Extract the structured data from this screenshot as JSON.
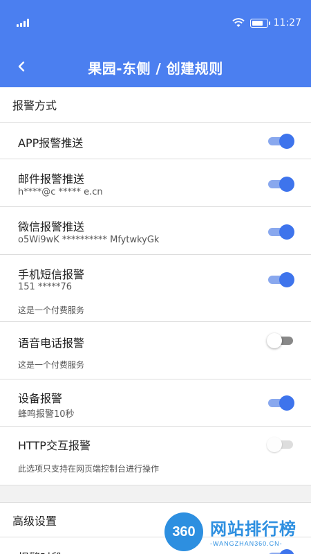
{
  "status_bar": {
    "time": "11:27",
    "battery_level": 0.8,
    "icons": [
      "signal-icon",
      "wifi-icon",
      "battery-icon"
    ]
  },
  "nav": {
    "back_icon": "chevron-left-icon",
    "title": "果园-东侧 / 创建规则"
  },
  "colors": {
    "primary": "#4b7ff0",
    "toggle_on": "#3e74ec",
    "toggle_on_track": "#89a8ee",
    "toggle_off_track": "#888888"
  },
  "alarm_section": {
    "header": "报警方式",
    "items": [
      {
        "label": "APP报警推送",
        "enabled": true
      },
      {
        "label": "邮件报警推送",
        "sub": "h****@c ***** e.cn",
        "enabled": true
      },
      {
        "label": "微信报警推送",
        "sub": "o5Wi9wK ********** MfytwkyGk",
        "enabled": true
      },
      {
        "label": "手机短信报警",
        "sub": "151 *****76",
        "note": "这是一个付费服务",
        "enabled": true
      },
      {
        "label": "语音电话报警",
        "note": "这是一个付费服务",
        "enabled": false
      },
      {
        "label": "设备报警",
        "sub": "蜂鸣报警10秒",
        "enabled": true
      },
      {
        "label": "HTTP交互报警",
        "note": "此选项只支持在网页端控制台进行操作",
        "enabled": false,
        "disabled": true
      }
    ]
  },
  "advanced_section": {
    "header": "高级设置",
    "items": [
      {
        "label": "报警时段",
        "enabled": true
      }
    ]
  },
  "watermark": {
    "badge": "360",
    "text": "网站排行榜",
    "sub": "-WANGZHAN360.CN-"
  }
}
